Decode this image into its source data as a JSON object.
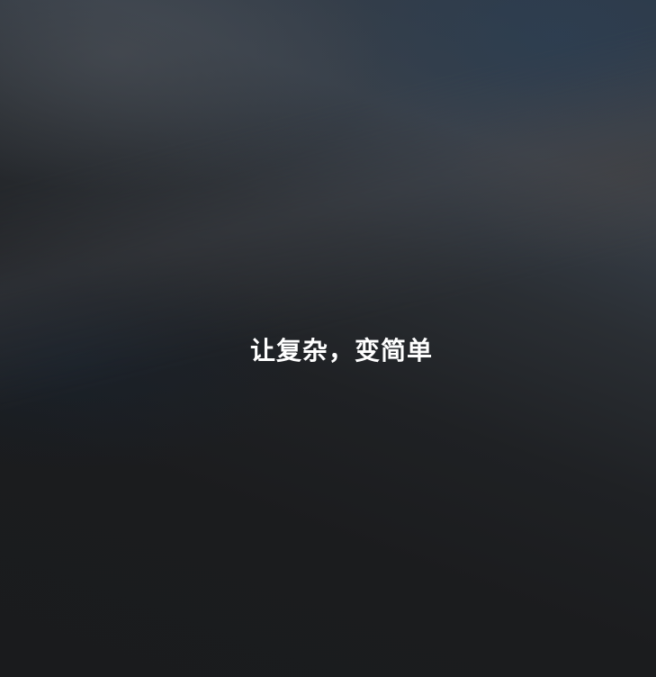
{
  "splash": {
    "slogan": "让复杂，变简单"
  },
  "colors": {
    "background": "#1a1b1d",
    "text": "#ffffff"
  }
}
